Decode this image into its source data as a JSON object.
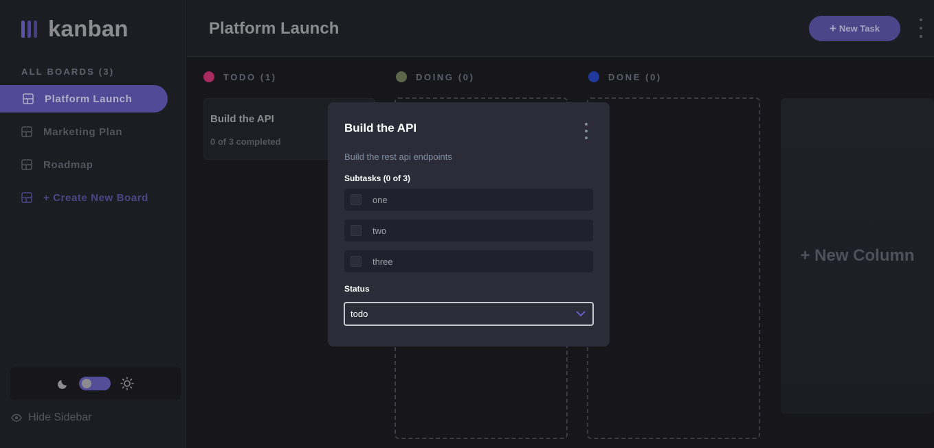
{
  "sidebar": {
    "logo_text": "kanban",
    "boards_heading": "ALL BOARDS (3)",
    "boards": [
      {
        "label": "Platform Launch"
      },
      {
        "label": "Marketing Plan"
      },
      {
        "label": "Roadmap"
      }
    ],
    "create_label": "+ Create New Board",
    "hide_label": "Hide Sidebar",
    "theme": "dark"
  },
  "header": {
    "title": "Platform Launch",
    "new_task_label": "New Task",
    "new_task_plus": "+"
  },
  "columns": [
    {
      "label": "TODO (1)",
      "color": "#a82a5f"
    },
    {
      "label": "DOING (0)",
      "color": "#5e6449"
    },
    {
      "label": "DONE (0)",
      "color": "#22399e"
    }
  ],
  "task_card": {
    "title": "Build the API",
    "subtitle": "0 of 3 completed"
  },
  "new_column_label": "+ New Column",
  "modal": {
    "title": "Build the API",
    "description": "Build the rest api endpoints",
    "subtasks_heading": "Subtasks (0 of 3)",
    "subtasks": [
      {
        "label": "one",
        "checked": false
      },
      {
        "label": "two",
        "checked": false
      },
      {
        "label": "three",
        "checked": false
      }
    ],
    "status_heading": "Status",
    "status_value": "todo"
  },
  "colors": {
    "accent": "#635fc7",
    "modal_bg": "#2b2c37",
    "subtask_bg": "#20212c"
  }
}
